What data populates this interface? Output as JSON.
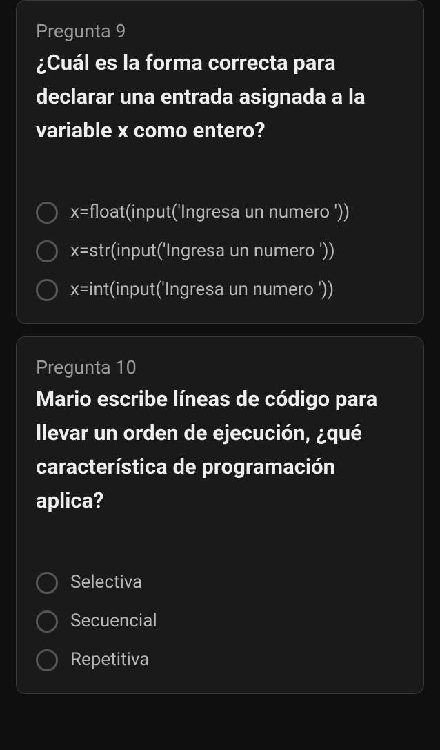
{
  "questions": [
    {
      "label": "Pregunta 9",
      "text": "¿Cuál es la forma correcta para declarar una entrada asignada a la variable x como entero?",
      "options": [
        "x=float(input('Ingresa un numero '))",
        "x=str(input('Ingresa un numero '))",
        "x=int(input('Ingresa un numero '))"
      ]
    },
    {
      "label": "Pregunta 10",
      "text": "Mario escribe líneas de código para llevar un orden de ejecución, ¿qué característica de programación aplica?",
      "options": [
        "Selectiva",
        "Secuencial",
        "Repetitiva"
      ]
    }
  ]
}
